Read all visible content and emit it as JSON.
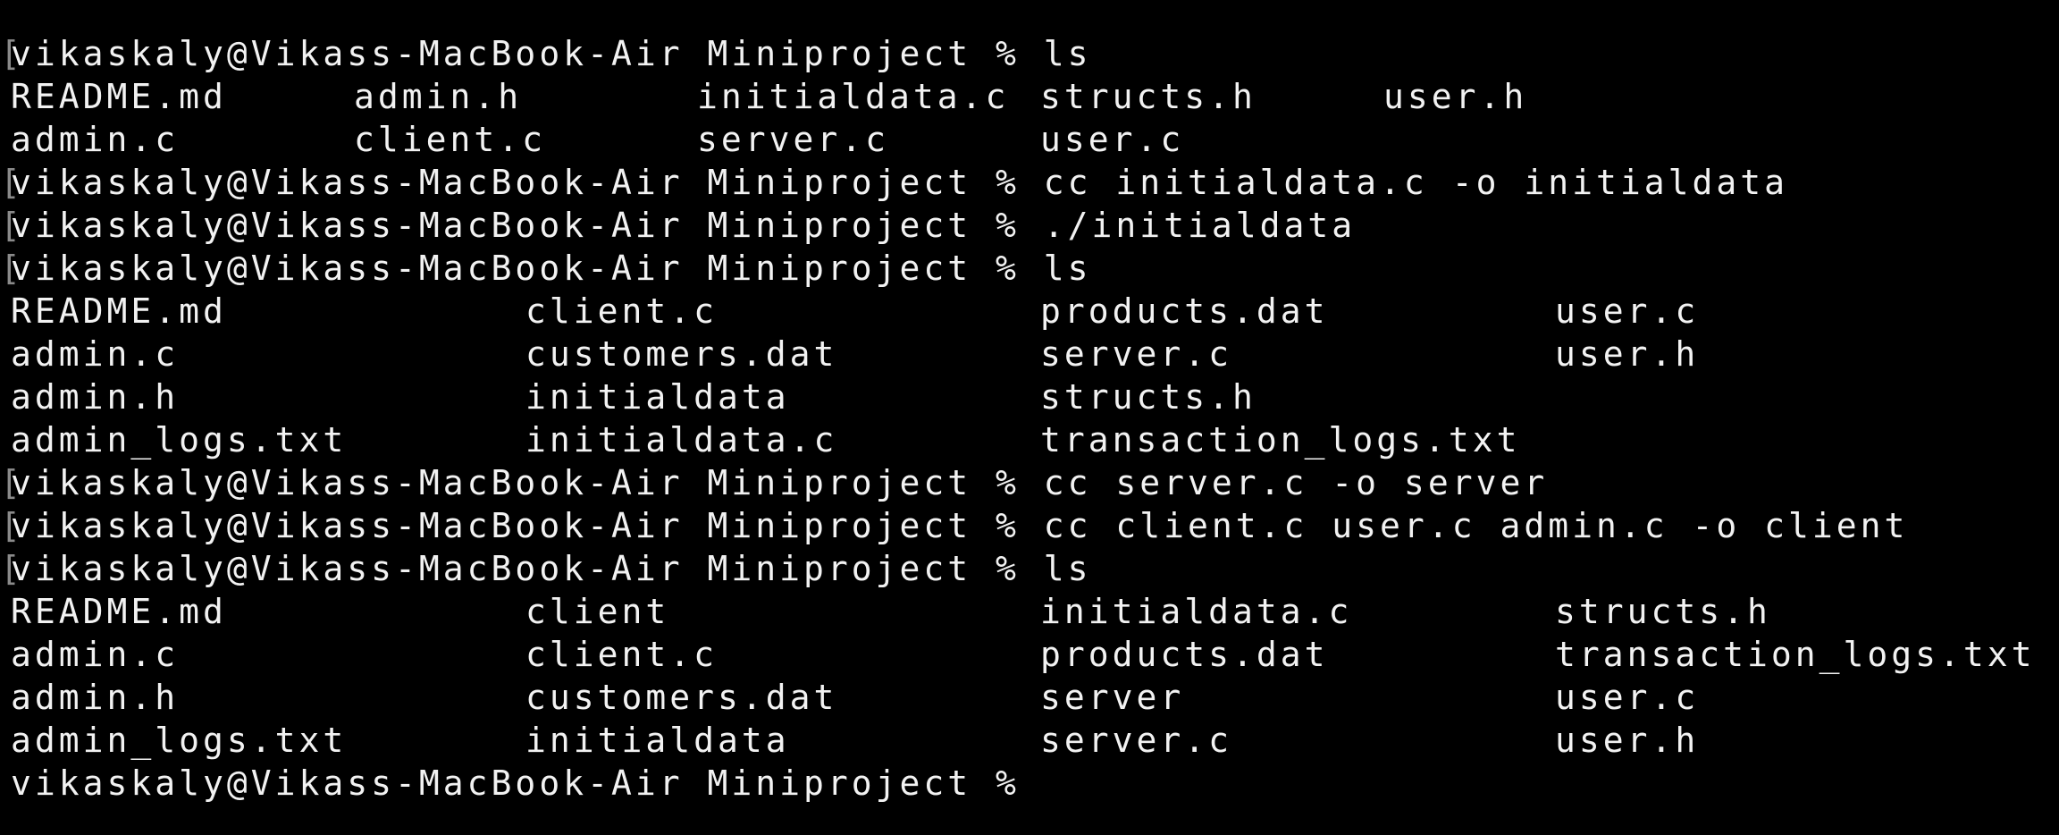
{
  "terminal": {
    "prompt": "vikaskaly@Vikass-MacBook-Air Miniproject %",
    "bracket_glyph": "[",
    "commands": {
      "ls1": "ls",
      "cc_initialdata": "cc initialdata.c -o initialdata",
      "run_initialdata": "./initialdata",
      "ls2": "ls",
      "cc_server": "cc server.c -o server",
      "cc_client": "cc client.c user.c admin.c -o client",
      "ls3": "ls"
    },
    "listing1": [
      [
        "README.md",
        "admin.h",
        "initialdata.c",
        "structs.h",
        "user.h"
      ],
      [
        "admin.c",
        "client.c",
        "server.c",
        "user.c",
        ""
      ]
    ],
    "listing2": [
      [
        "README.md",
        "client.c",
        "products.dat",
        "user.c"
      ],
      [
        "admin.c",
        "customers.dat",
        "server.c",
        "user.h"
      ],
      [
        "admin.h",
        "initialdata",
        "structs.h",
        ""
      ],
      [
        "admin_logs.txt",
        "initialdata.c",
        "transaction_logs.txt",
        ""
      ]
    ],
    "listing3": [
      [
        "README.md",
        "client",
        "initialdata.c",
        "structs.h"
      ],
      [
        "admin.c",
        "client.c",
        "products.dat",
        "transaction_logs.txt"
      ],
      [
        "admin.h",
        "customers.dat",
        "server",
        "user.c"
      ],
      [
        "admin_logs.txt",
        "initialdata",
        "server.c",
        "user.h"
      ]
    ]
  }
}
